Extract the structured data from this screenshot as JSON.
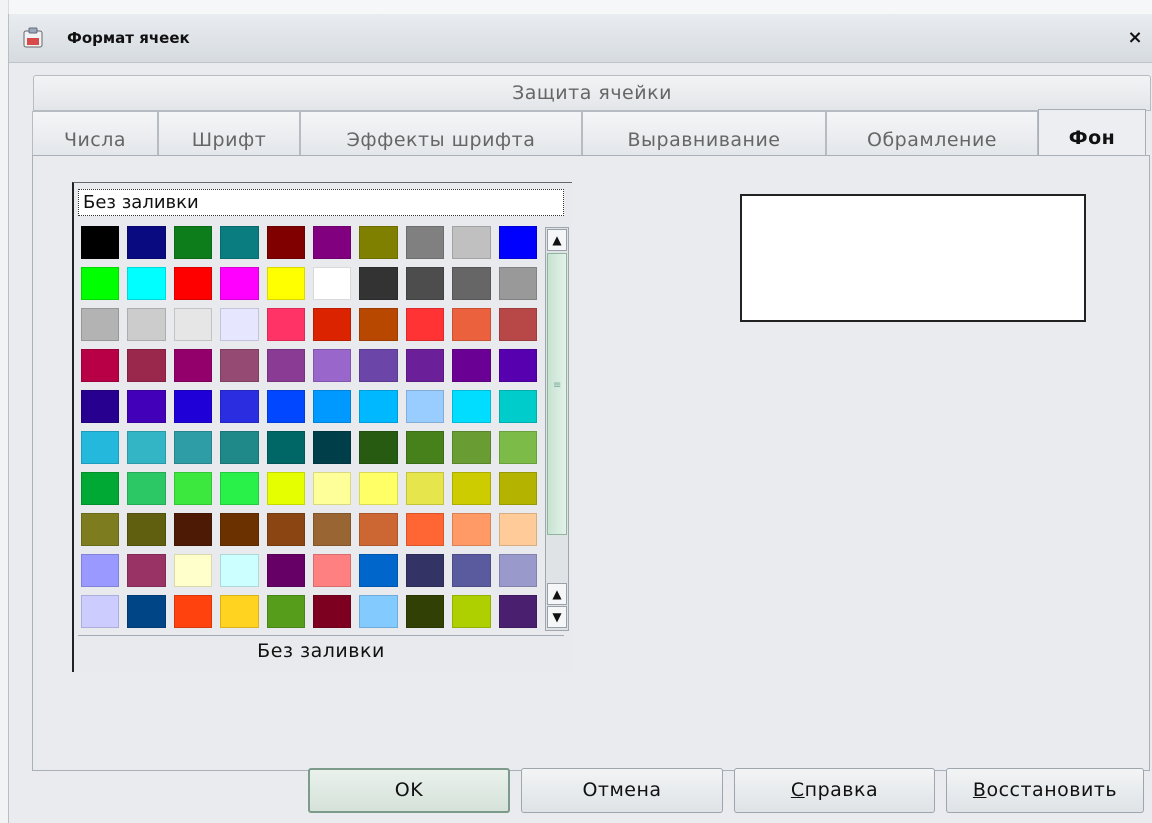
{
  "window": {
    "title": "Формат ячеек",
    "close_label": "×"
  },
  "tabs": {
    "row1": [
      "Защита ячейки"
    ],
    "row2": [
      "Числа",
      "Шрифт",
      "Эффекты шрифта",
      "Выравнивание",
      "Обрамление",
      "Фон"
    ],
    "active": "Фон"
  },
  "color_selector": {
    "selected_value": "Без заливки",
    "caption": "Без заливки",
    "swatches": [
      "#000000",
      "#0a0a80",
      "#0d7d1c",
      "#0a7d80",
      "#800000",
      "#800080",
      "#808000",
      "#808080",
      "#c0c0c0",
      "#0000ff",
      "#00ff00",
      "#00ffff",
      "#ff0000",
      "#ff00ff",
      "#ffff00",
      "#ffffff",
      "#333333",
      "#4d4d4d",
      "#666666",
      "#999999",
      "#b3b3b3",
      "#cccccc",
      "#e6e6e6",
      "#e6e6ff",
      "#ff3366",
      "#dc2300",
      "#b84700",
      "#ff3333",
      "#eb613d",
      "#b84747",
      "#b80047",
      "#99284c",
      "#94006b",
      "#944a72",
      "#8a3c95",
      "#9966cc",
      "#6b45a8",
      "#6b1f99",
      "#6b0094",
      "#5600b0",
      "#28008f",
      "#4200b8",
      "#1f00d6",
      "#2a2ee0",
      "#0047ff",
      "#0099ff",
      "#00b8ff",
      "#99ccff",
      "#00ddff",
      "#00cccc",
      "#23b8dc",
      "#33b5c6",
      "#2f9da6",
      "#1f8889",
      "#006666",
      "#003f4a",
      "#275b12",
      "#46811c",
      "#6a9c34",
      "#7dbb49",
      "#00a933",
      "#2dc866",
      "#3de83e",
      "#2af04a",
      "#e6ff00",
      "#ffff99",
      "#ffff66",
      "#e6e64c",
      "#cccc00",
      "#b3b300",
      "#7d7d20",
      "#5f5f0f",
      "#4c1a05",
      "#6b3200",
      "#8b4513",
      "#996633",
      "#cc6633",
      "#ff6633",
      "#ff9966",
      "#ffcc99",
      "#9999ff",
      "#993366",
      "#ffffcc",
      "#ccffff",
      "#660066",
      "#ff8080",
      "#0066cc",
      "#333366",
      "#5a5a9e",
      "#9999cc",
      "#ccccff",
      "#004586",
      "#ff420e",
      "#ffd320",
      "#579d1c",
      "#7e0021",
      "#83caff",
      "#314004",
      "#aecf00",
      "#4b1f6f"
    ]
  },
  "preview": {
    "color": "#ffffff"
  },
  "buttons": {
    "ok": "OK",
    "cancel": "Отмена",
    "help": "Справка",
    "reset": "Восстановить"
  }
}
